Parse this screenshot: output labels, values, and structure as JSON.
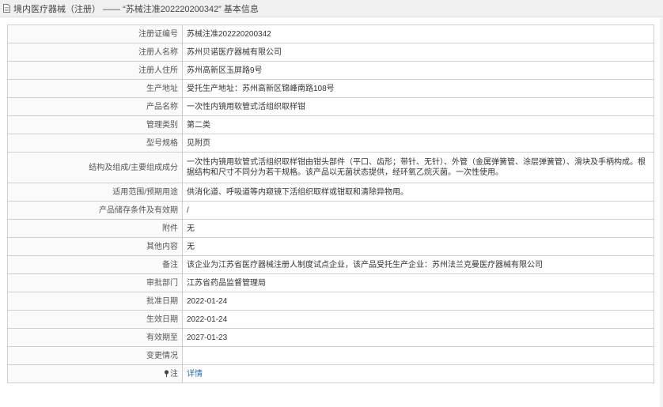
{
  "header": {
    "title": "境内医疗器械（注册） —— “苏械注准202220200342” 基本信息",
    "icon": "document-icon"
  },
  "rows": [
    {
      "label": "注册证编号",
      "value": "苏械注准202220200342"
    },
    {
      "label": "注册人名称",
      "value": "苏州贝诺医疗器械有限公司"
    },
    {
      "label": "注册人住所",
      "value": "苏州高新区玉屏路9号"
    },
    {
      "label": "生产地址",
      "value": "受托生产地址：苏州高新区锦峰南路108号"
    },
    {
      "label": "产品名称",
      "value": "一次性内镜用软管式活组织取样钳"
    },
    {
      "label": "管理类别",
      "value": "第二类"
    },
    {
      "label": "型号规格",
      "value": "见附页"
    },
    {
      "label": "结构及组成/主要组成成分",
      "value": "一次性内镜用软管式活组织取样钳由钳头部件（平口、齿形；带针、无针）、外管（金属弹簧管、涂层弹簧管）、滑块及手柄构成。根据结构和尺寸不同分为若干规格。该产品以无菌状态提供，经环氧乙烷灭菌。一次性使用。"
    },
    {
      "label": "适用范围/预期用途",
      "value": "供消化道、呼吸道等内窥镜下活组织取样或钳取和清除异物用。"
    },
    {
      "label": "产品储存条件及有效期",
      "value": "/"
    },
    {
      "label": "附件",
      "value": "无"
    },
    {
      "label": "其他内容",
      "value": "无"
    },
    {
      "label": "备注",
      "value": "该企业为江苏省医疗器械注册人制度试点企业，该产品受托生产企业：苏州法兰克曼医疗器械有限公司"
    },
    {
      "label": "审批部门",
      "value": "江苏省药品监督管理局"
    },
    {
      "label": "批准日期",
      "value": "2022-01-24"
    },
    {
      "label": "生效日期",
      "value": "2022-01-24"
    },
    {
      "label": "有效期至",
      "value": "2027-01-23"
    },
    {
      "label": "变更情况",
      "value": ""
    }
  ],
  "note": {
    "label": "注",
    "icon": "pin-icon",
    "link_text": "详情"
  },
  "colors": {
    "link": "#2a6bb5",
    "border": "#cfcfcf",
    "titlebar_bg": "#f0f0f0"
  }
}
